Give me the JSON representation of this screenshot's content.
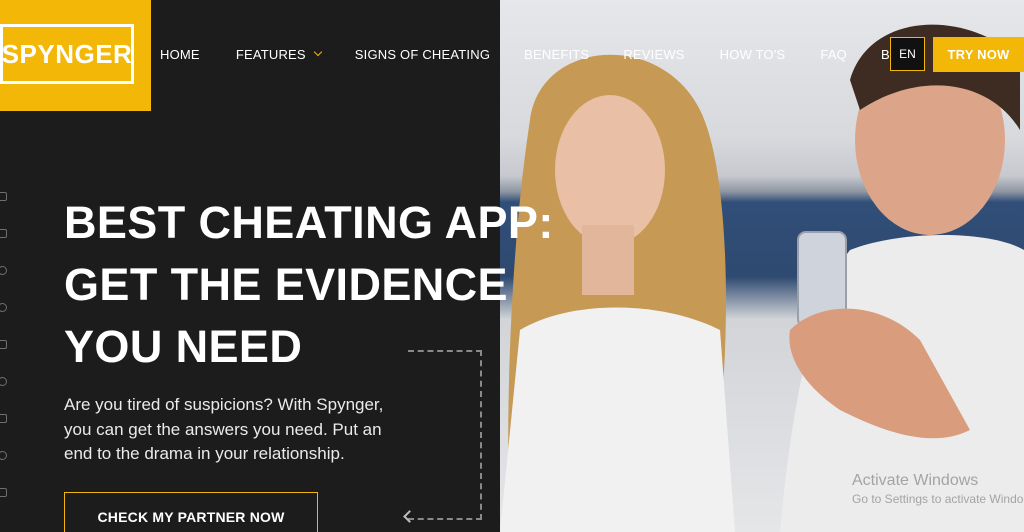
{
  "brand": {
    "logo_text": "SPYNGER",
    "accent_color": "#f3b707"
  },
  "nav": {
    "items": [
      {
        "label": "HOME"
      },
      {
        "label": "FEATURES",
        "has_dropdown": true
      },
      {
        "label": "SIGNS OF CHEATING"
      },
      {
        "label": "BENEFITS"
      },
      {
        "label": "REVIEWS"
      },
      {
        "label": "HOW TO'S"
      },
      {
        "label": "FAQ"
      },
      {
        "label": "BLOG"
      }
    ],
    "language": "EN",
    "cta_label": "TRY NOW"
  },
  "social": {
    "icons": [
      "facebook-icon",
      "instagram-icon",
      "twitter-icon",
      "whatsapp-icon",
      "telegram-icon",
      "messenger-icon",
      "camera-icon",
      "chat-icon",
      "phone-icon"
    ]
  },
  "hero": {
    "title_lines": [
      "BEST CHEATING APP:",
      "GET THE EVIDENCE",
      "YOU NEED"
    ],
    "subtitle": "Are you tired of suspicions? With Spynger, you can get the answers you need. Put an end to the drama in your relationship.",
    "cta_label": "CHECK MY PARTNER NOW"
  },
  "watermark": {
    "title": "Activate Windows",
    "subtitle": "Go to Settings to activate Windo"
  }
}
